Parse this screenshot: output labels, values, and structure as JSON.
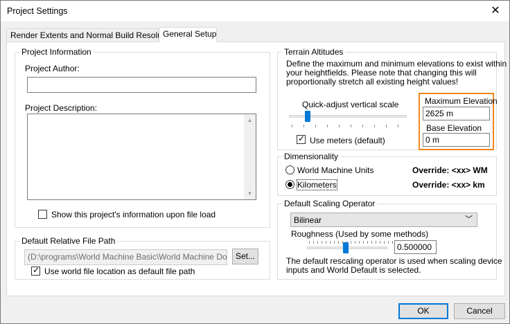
{
  "window": {
    "title": "Project Settings"
  },
  "tabs": [
    {
      "label": "Render Extents and Normal Build Resolution",
      "active": false
    },
    {
      "label": "General Setup",
      "active": true
    }
  ],
  "project_info": {
    "legend": "Project Information",
    "author_label": "Project Author:",
    "author_value": "",
    "description_label": "Project Description:",
    "description_value": "",
    "show_on_load_label": "Show this project's information upon file load",
    "show_on_load_checked": false
  },
  "file_path": {
    "legend": "Default Relative File Path",
    "path_value": "(D:\\programs\\World Machine Basic\\World Machine Docume",
    "set_label": "Set...",
    "use_world_label": "Use world file location as default file path",
    "use_world_checked": true
  },
  "terrain": {
    "legend": "Terrain Altitudes",
    "description": [
      "Define the maximum and minimum elevations to exist within",
      "your heightfields. Please note that changing this will",
      "proportionally stretch all existing height values!"
    ],
    "quick_adjust_label": "Quick-adjust vertical scale",
    "use_meters_label": "Use meters (default)",
    "use_meters_checked": true,
    "max_label": "Maximum Elevation",
    "max_value": "2625 m",
    "base_label": "Base Elevation",
    "base_value": "0 m",
    "highlight_color": "#f0861e"
  },
  "dimensionality": {
    "legend": "Dimensionality",
    "options": [
      {
        "label": "World Machine Units",
        "override": "Override: <xx> WM",
        "selected": false
      },
      {
        "label": "Kilometers",
        "override": "Override: <xx> km",
        "selected": true
      }
    ]
  },
  "scaling": {
    "legend": "Default Scaling Operator",
    "selected": "Bilinear",
    "roughness_label": "Roughness (Used by some methods)",
    "roughness_value": "0.500000",
    "note": [
      "The default rescaling operator is used when scaling device",
      "inputs and World Default is selected."
    ]
  },
  "footer": {
    "ok_label": "OK",
    "cancel_label": "Cancel"
  },
  "accent_color": "#0078d7"
}
